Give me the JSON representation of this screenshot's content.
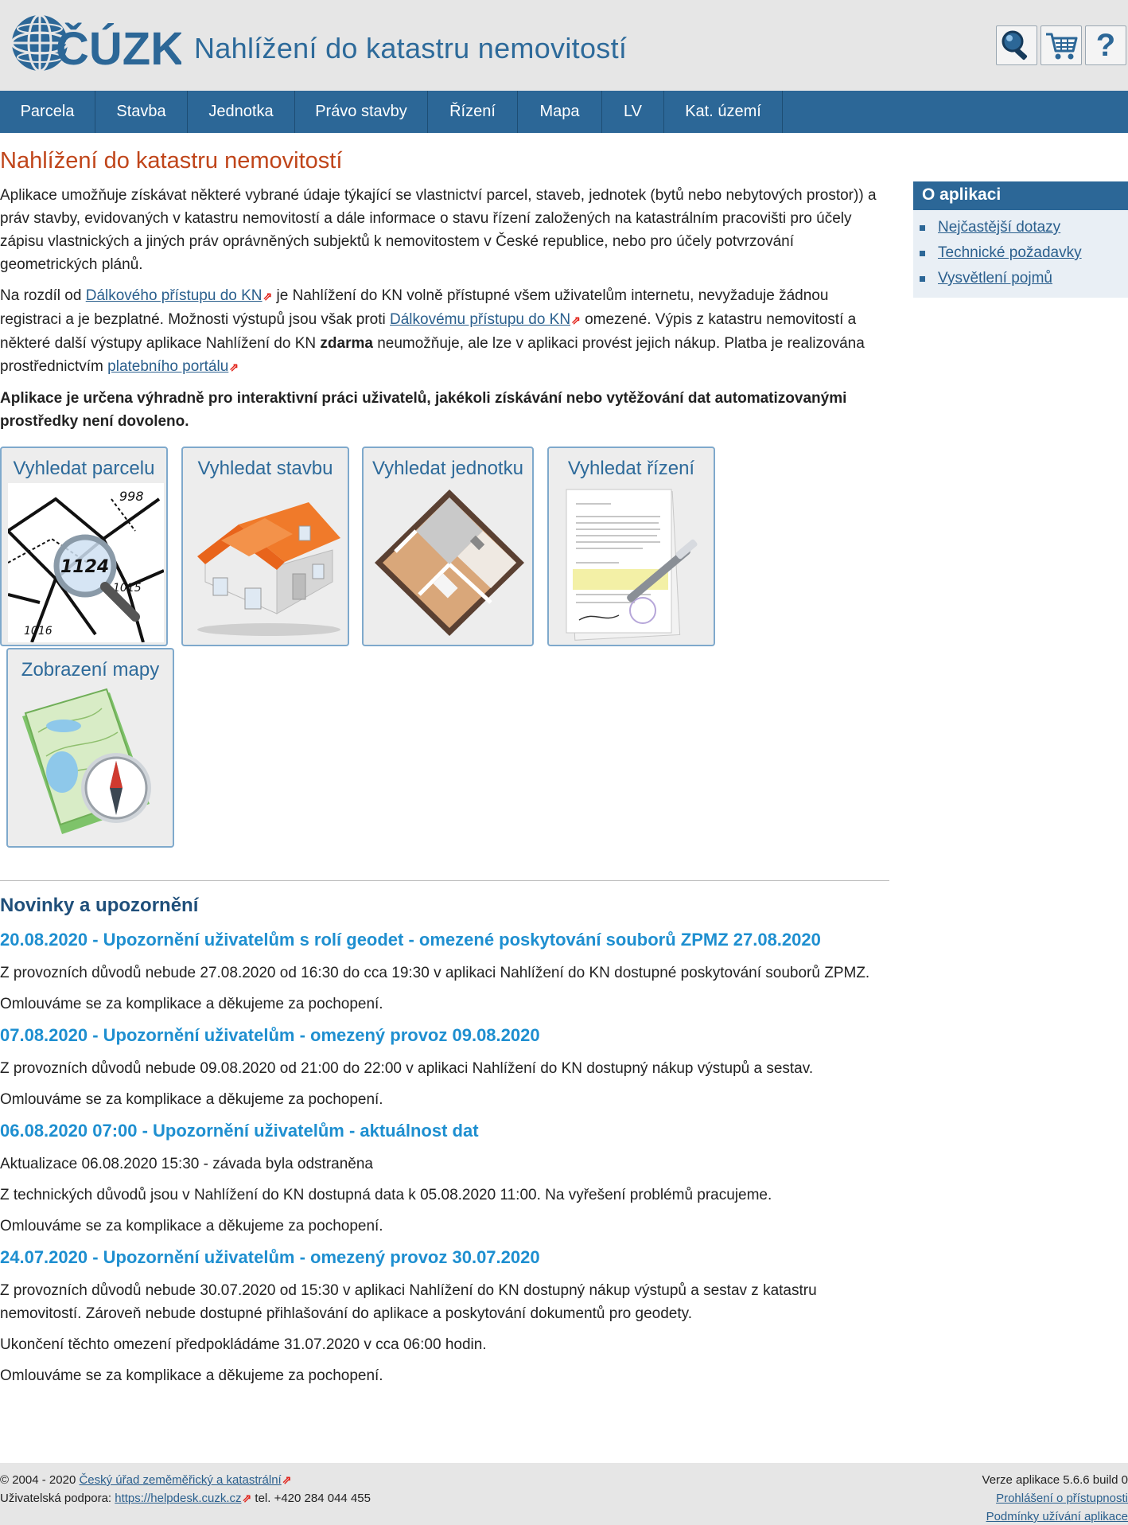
{
  "header": {
    "logo_text": "ČÚZK",
    "title": "Nahlížení do katastru nemovitostí",
    "buttons": [
      {
        "icon": "search-key-icon"
      },
      {
        "icon": "cart-icon"
      },
      {
        "icon": "help-icon",
        "glyph": "?"
      }
    ]
  },
  "nav": {
    "items": [
      {
        "label": "Parcela"
      },
      {
        "label": "Stavba"
      },
      {
        "label": "Jednotka"
      },
      {
        "label": "Právo stavby"
      },
      {
        "label": "Řízení"
      },
      {
        "label": "Mapa"
      },
      {
        "label": "LV"
      },
      {
        "label": "Kat. území"
      }
    ]
  },
  "main": {
    "title": "Nahlížení do katastru nemovitostí",
    "intro": "Aplikace umožňuje získávat některé vybrané údaje týkající se vlastnictví parcel, staveb, jednotek (bytů nebo nebytových prostor)) a práv stavby, evidovaných v katastru nemovitostí a dále informace o stavu řízení založených na katastrálním pracovišti pro účely zápisu vlastnických a jiných práv oprávněných subjektů k nemovitostem v České republice, nebo pro účely potvrzování geometrických plánů.",
    "p2": {
      "t1": "Na rozdíl od ",
      "link1": "Dálkového přístupu do KN",
      "t2": " je Nahlížení do KN volně přístupné všem uživatelům internetu, nevyžaduje žádnou registraci a je bezplatné. Možnosti výstupů jsou však proti ",
      "link2": "Dálkovému přístupu do KN",
      "t3": " omezené. Výpis z katastru nemovitostí a některé další výstupy aplikace Nahlížení do KN ",
      "bold": "zdarma",
      "t4": " neumožňuje, ale lze v aplikaci provést jejich nákup. Platba je realizována prostřednictvím ",
      "link3": "platebního portálu"
    },
    "warning": "Aplikace je určena výhradně pro interaktivní práci uživatelů, jakékoli získávání nebo vytěžování dat automatizovanými prostředky není dovoleno.",
    "ext_mark": "⇗",
    "tiles": [
      {
        "label": "Vyhledat parcelu",
        "icon": "parcel-map-magnifier-icon",
        "map_numbers": [
          "998",
          "1124",
          "1015",
          "1016"
        ]
      },
      {
        "label": "Vyhledat stavbu",
        "icon": "house-icon"
      },
      {
        "label": "Vyhledat jednotku",
        "icon": "apartment-floorplan-icon"
      },
      {
        "label": "Vyhledat řízení",
        "icon": "document-pen-icon"
      },
      {
        "label": "Zobrazení mapy",
        "icon": "map-compass-icon"
      }
    ]
  },
  "sidebar": {
    "title": "O aplikaci",
    "items": [
      {
        "label": "Nejčastější dotazy"
      },
      {
        "label": "Technické požadavky"
      },
      {
        "label": "Vysvětlení pojmů"
      }
    ]
  },
  "news": {
    "title": "Novinky a upozornění",
    "items": [
      {
        "head": "20.08.2020 - Upozornění uživatelům s rolí geodet - omezené poskytování souborů ZPMZ 27.08.2020",
        "paragraphs": [
          "Z provozních důvodů nebude 27.08.2020 od 16:30 do cca 19:30 v aplikaci Nahlížení do KN dostupné poskytování souborů ZPMZ.",
          "Omlouváme se za komplikace a děkujeme za pochopení."
        ]
      },
      {
        "head": "07.08.2020 - Upozornění uživatelům - omezený provoz 09.08.2020",
        "paragraphs": [
          "Z provozních důvodů nebude 09.08.2020 od 21:00 do 22:00 v aplikaci Nahlížení do KN dostupný nákup výstupů a sestav.",
          "Omlouváme se za komplikace a děkujeme za pochopení."
        ]
      },
      {
        "head": "06.08.2020 07:00 - Upozornění uživatelům - aktuálnost dat",
        "paragraphs": [
          "Aktualizace 06.08.2020 15:30 - závada byla odstraněna",
          "Z technických důvodů jsou v Nahlížení do KN dostupná data k 05.08.2020 11:00. Na vyřešení problémů pracujeme.",
          "Omlouváme se za komplikace a děkujeme za pochopení."
        ]
      },
      {
        "head": "24.07.2020 - Upozornění uživatelům - omezený provoz 30.07.2020",
        "paragraphs": [
          "Z provozních důvodů nebude 30.07.2020 od 15:30 v aplikaci Nahlížení do KN dostupný nákup výstupů a sestav z katastru nemovitostí. Zároveň nebude dostupné přihlašování do aplikace a poskytování dokumentů pro geodety.",
          "Ukončení těchto omezení předpokládáme 31.07.2020 v cca 06:00 hodin.",
          "Omlouváme se za komplikace a děkujeme za pochopení."
        ]
      }
    ]
  },
  "footer": {
    "copyright": "© 2004 - 2020 ",
    "org_link": "Český úřad zeměměřický a katastrální",
    "support_label": "Uživatelská podpora: ",
    "support_link": "https://helpdesk.cuzk.cz",
    "phone": " tel. +420 284 044 455",
    "version": "Verze aplikace 5.6.6 build 0",
    "accessibility_link": "Prohlášení o přístupnosti",
    "terms_link": "Podmínky užívání aplikace"
  },
  "colors": {
    "nav_bg": "#2c6797",
    "title_orange": "#c0451a",
    "news_head_blue": "#1e8fd0",
    "link": "#2a5f8d",
    "header_bg": "#e6e6e6"
  }
}
